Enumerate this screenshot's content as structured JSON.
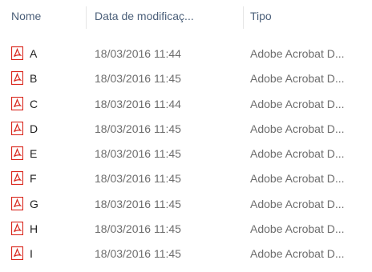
{
  "columns": {
    "name": "Nome",
    "date": "Data de modificaç...",
    "type": "Tipo"
  },
  "files": [
    {
      "name": "A",
      "date": "18/03/2016 11:44",
      "type": "Adobe Acrobat D...",
      "icon": "pdf-file-icon"
    },
    {
      "name": "B",
      "date": "18/03/2016 11:45",
      "type": "Adobe Acrobat D...",
      "icon": "pdf-file-icon"
    },
    {
      "name": "C",
      "date": "18/03/2016 11:44",
      "type": "Adobe Acrobat D...",
      "icon": "pdf-file-icon"
    },
    {
      "name": "D",
      "date": "18/03/2016 11:45",
      "type": "Adobe Acrobat D...",
      "icon": "pdf-file-icon"
    },
    {
      "name": "E",
      "date": "18/03/2016 11:45",
      "type": "Adobe Acrobat D...",
      "icon": "pdf-file-icon"
    },
    {
      "name": "F",
      "date": "18/03/2016 11:45",
      "type": "Adobe Acrobat D...",
      "icon": "pdf-file-icon"
    },
    {
      "name": "G",
      "date": "18/03/2016 11:45",
      "type": "Adobe Acrobat D...",
      "icon": "pdf-file-icon"
    },
    {
      "name": "H",
      "date": "18/03/2016 11:45",
      "type": "Adobe Acrobat D...",
      "icon": "pdf-file-icon"
    },
    {
      "name": "I",
      "date": "18/03/2016 11:45",
      "type": "Adobe Acrobat D...",
      "icon": "pdf-file-icon"
    }
  ],
  "colors": {
    "header_text": "#4c607a",
    "name_text": "#1f1f1f",
    "secondary_text": "#6d6d6d",
    "pdf_icon": "#d9261c"
  }
}
